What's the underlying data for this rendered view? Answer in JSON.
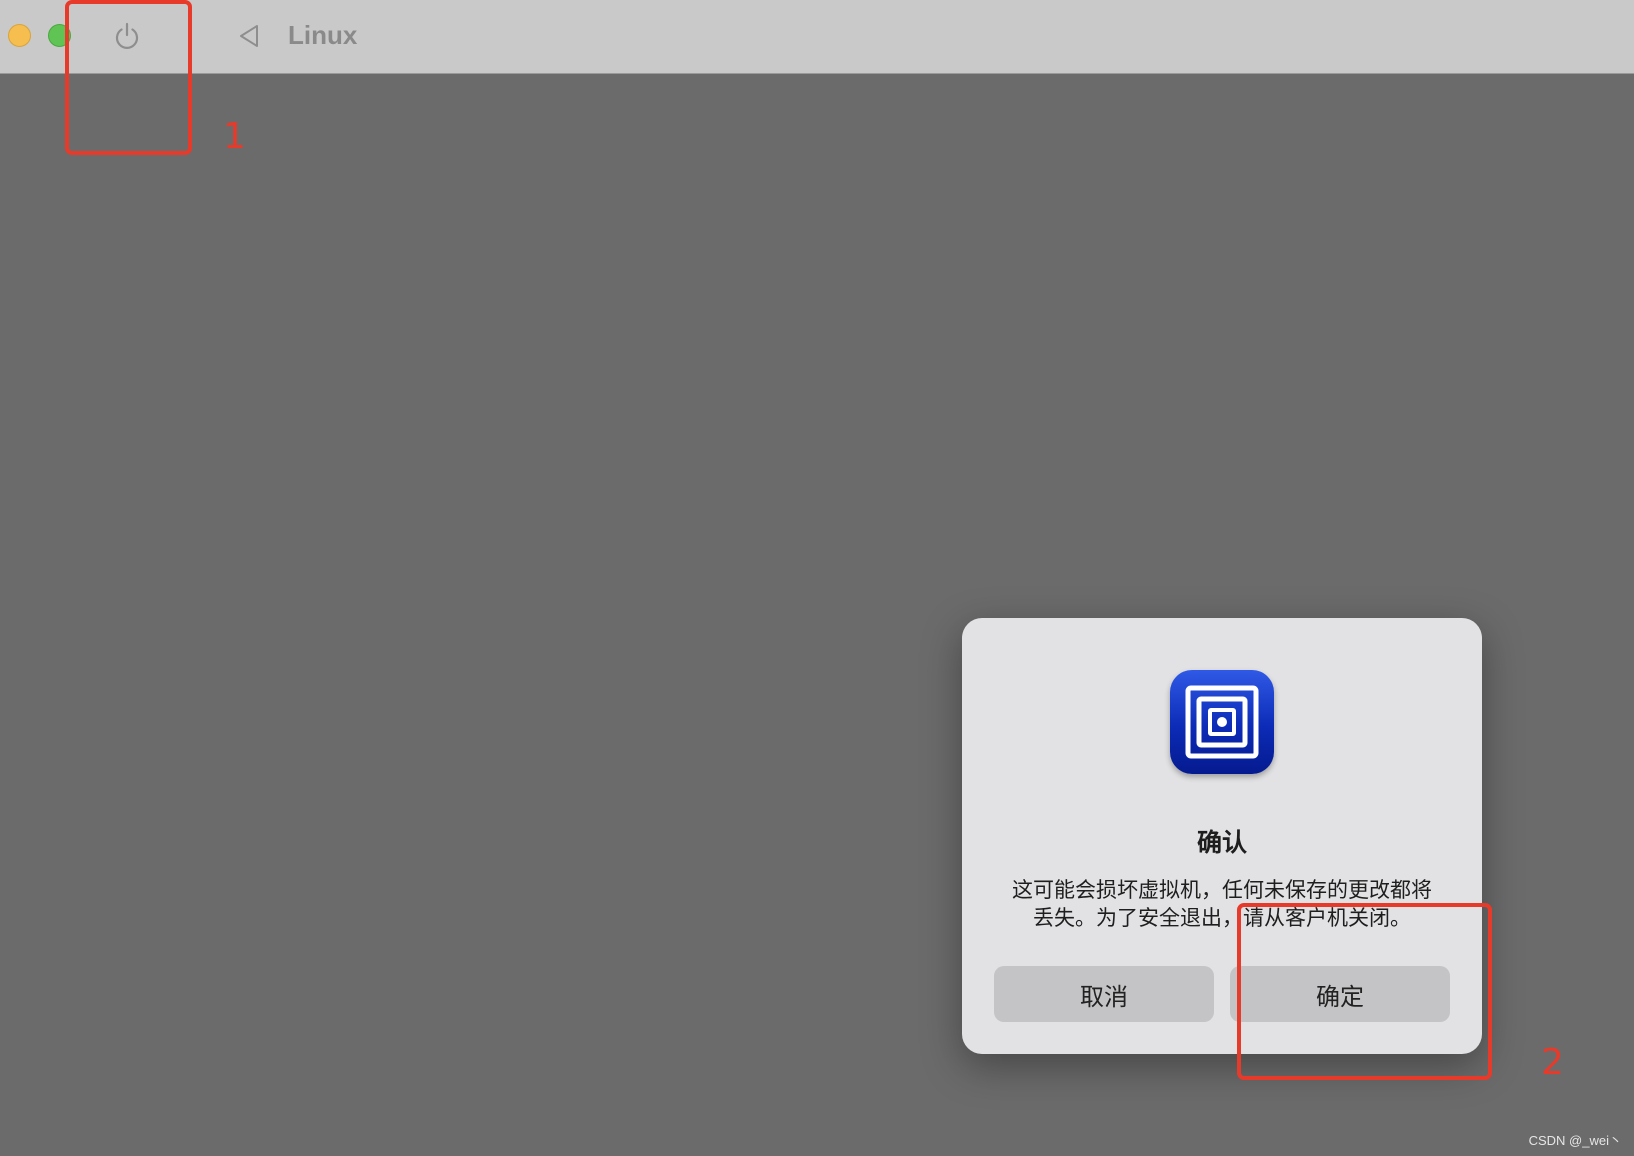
{
  "window": {
    "title": "Linux",
    "toolbar": {
      "minimize_icon": "yellow-traffic-light",
      "zoom_icon": "green-traffic-light",
      "power_icon": "power-icon",
      "pause_icon": "pause-icon",
      "back_icon": "triangle-left-icon"
    }
  },
  "annotations": {
    "label_1": "1",
    "label_2": "2",
    "color": "#e83a2a"
  },
  "dialog": {
    "icon": "utm-app-icon",
    "title": "确认",
    "message": "这可能会损坏虚拟机，任何未保存的更改都将丢失。为了安全退出，请从客户机关闭。",
    "cancel_label": "取消",
    "confirm_label": "确定"
  },
  "watermark": "CSDN @_wei丶",
  "colors": {
    "desktop_background": "#6b6b6b",
    "titlebar": "#c9c9c9",
    "dialog_background": "#e2e2e4",
    "button_background": "#c4c4c6",
    "icon_blue": "#1537c7"
  }
}
